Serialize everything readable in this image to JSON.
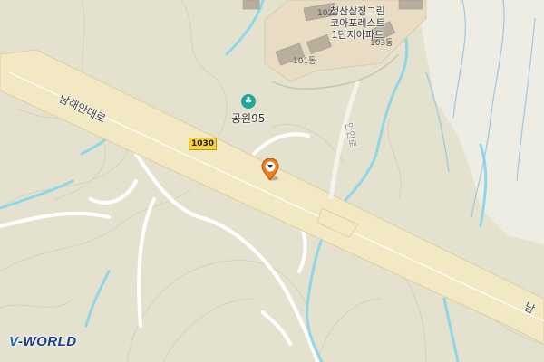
{
  "map": {
    "road_labels": {
      "main_road": "남해안대로",
      "main_road_edge": "남",
      "side_road": "안인로"
    },
    "route_shield": "1030",
    "park": {
      "name": "공원95",
      "icon": "park-icon"
    },
    "complex": {
      "line1": "청산삼정그린",
      "line2": "코아포레스트",
      "line3": "1단지아파트"
    },
    "buildings": {
      "b101": "101동",
      "b102": "102",
      "b103": "103동"
    },
    "marker_icon": "location-pin-icon",
    "logo": {
      "prefix": "V",
      "text": "-WORLD"
    },
    "colors": {
      "terrain": "#e4e2cf",
      "highway": "#f2e9c4",
      "water": "#8fd6e6",
      "park_icon": "#1aa99a",
      "pin": "#f07d1a",
      "route_shield": "#f6d33c"
    }
  }
}
